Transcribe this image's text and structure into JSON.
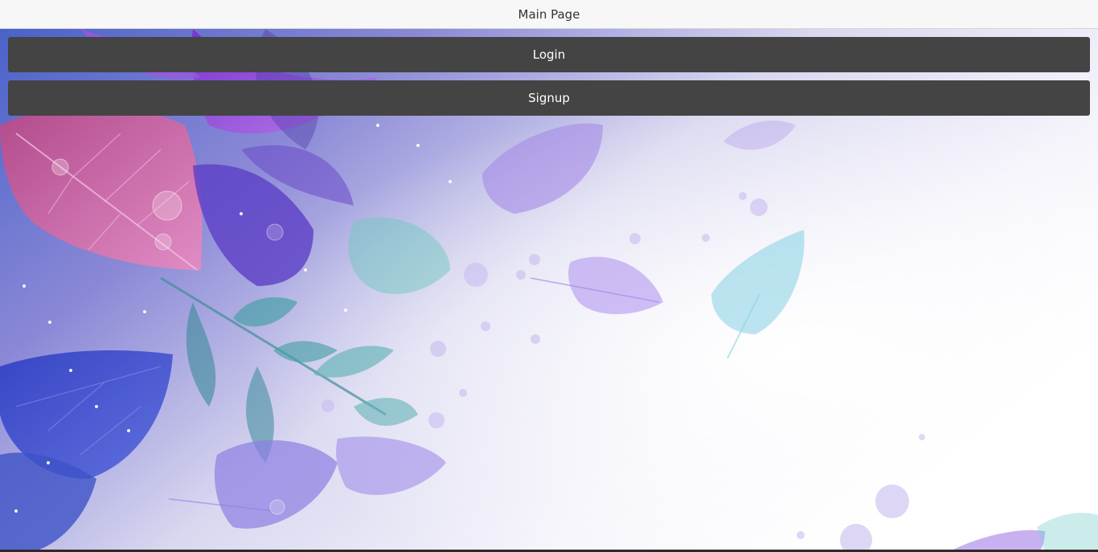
{
  "app": {
    "title": "Main Page"
  },
  "buttons": {
    "login_label": "Login",
    "signup_label": "Signup"
  },
  "theme": {
    "button_bg": "#444444",
    "button_text": "#ffffff",
    "titlebar_bg": "#f7f7f7"
  },
  "background": {
    "description_icon": "leaf-pattern"
  }
}
